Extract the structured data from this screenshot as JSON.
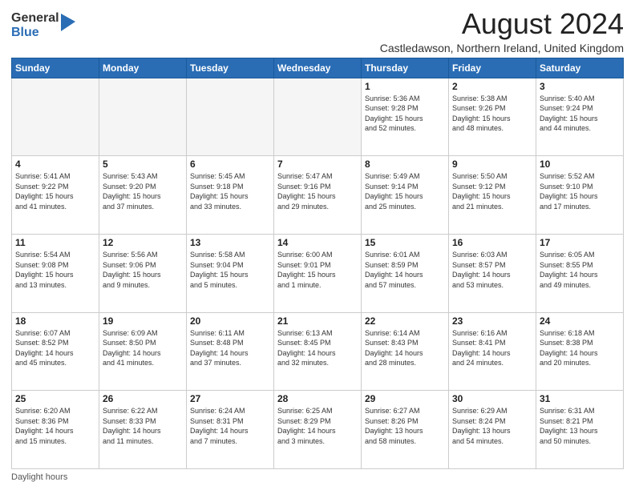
{
  "logo": {
    "general": "General",
    "blue": "Blue"
  },
  "title": "August 2024",
  "subtitle": "Castledawson, Northern Ireland, United Kingdom",
  "days_of_week": [
    "Sunday",
    "Monday",
    "Tuesday",
    "Wednesday",
    "Thursday",
    "Friday",
    "Saturday"
  ],
  "footer": "Daylight hours",
  "weeks": [
    [
      {
        "day": "",
        "info": ""
      },
      {
        "day": "",
        "info": ""
      },
      {
        "day": "",
        "info": ""
      },
      {
        "day": "",
        "info": ""
      },
      {
        "day": "1",
        "info": "Sunrise: 5:36 AM\nSunset: 9:28 PM\nDaylight: 15 hours\nand 52 minutes."
      },
      {
        "day": "2",
        "info": "Sunrise: 5:38 AM\nSunset: 9:26 PM\nDaylight: 15 hours\nand 48 minutes."
      },
      {
        "day": "3",
        "info": "Sunrise: 5:40 AM\nSunset: 9:24 PM\nDaylight: 15 hours\nand 44 minutes."
      }
    ],
    [
      {
        "day": "4",
        "info": "Sunrise: 5:41 AM\nSunset: 9:22 PM\nDaylight: 15 hours\nand 41 minutes."
      },
      {
        "day": "5",
        "info": "Sunrise: 5:43 AM\nSunset: 9:20 PM\nDaylight: 15 hours\nand 37 minutes."
      },
      {
        "day": "6",
        "info": "Sunrise: 5:45 AM\nSunset: 9:18 PM\nDaylight: 15 hours\nand 33 minutes."
      },
      {
        "day": "7",
        "info": "Sunrise: 5:47 AM\nSunset: 9:16 PM\nDaylight: 15 hours\nand 29 minutes."
      },
      {
        "day": "8",
        "info": "Sunrise: 5:49 AM\nSunset: 9:14 PM\nDaylight: 15 hours\nand 25 minutes."
      },
      {
        "day": "9",
        "info": "Sunrise: 5:50 AM\nSunset: 9:12 PM\nDaylight: 15 hours\nand 21 minutes."
      },
      {
        "day": "10",
        "info": "Sunrise: 5:52 AM\nSunset: 9:10 PM\nDaylight: 15 hours\nand 17 minutes."
      }
    ],
    [
      {
        "day": "11",
        "info": "Sunrise: 5:54 AM\nSunset: 9:08 PM\nDaylight: 15 hours\nand 13 minutes."
      },
      {
        "day": "12",
        "info": "Sunrise: 5:56 AM\nSunset: 9:06 PM\nDaylight: 15 hours\nand 9 minutes."
      },
      {
        "day": "13",
        "info": "Sunrise: 5:58 AM\nSunset: 9:04 PM\nDaylight: 15 hours\nand 5 minutes."
      },
      {
        "day": "14",
        "info": "Sunrise: 6:00 AM\nSunset: 9:01 PM\nDaylight: 15 hours\nand 1 minute."
      },
      {
        "day": "15",
        "info": "Sunrise: 6:01 AM\nSunset: 8:59 PM\nDaylight: 14 hours\nand 57 minutes."
      },
      {
        "day": "16",
        "info": "Sunrise: 6:03 AM\nSunset: 8:57 PM\nDaylight: 14 hours\nand 53 minutes."
      },
      {
        "day": "17",
        "info": "Sunrise: 6:05 AM\nSunset: 8:55 PM\nDaylight: 14 hours\nand 49 minutes."
      }
    ],
    [
      {
        "day": "18",
        "info": "Sunrise: 6:07 AM\nSunset: 8:52 PM\nDaylight: 14 hours\nand 45 minutes."
      },
      {
        "day": "19",
        "info": "Sunrise: 6:09 AM\nSunset: 8:50 PM\nDaylight: 14 hours\nand 41 minutes."
      },
      {
        "day": "20",
        "info": "Sunrise: 6:11 AM\nSunset: 8:48 PM\nDaylight: 14 hours\nand 37 minutes."
      },
      {
        "day": "21",
        "info": "Sunrise: 6:13 AM\nSunset: 8:45 PM\nDaylight: 14 hours\nand 32 minutes."
      },
      {
        "day": "22",
        "info": "Sunrise: 6:14 AM\nSunset: 8:43 PM\nDaylight: 14 hours\nand 28 minutes."
      },
      {
        "day": "23",
        "info": "Sunrise: 6:16 AM\nSunset: 8:41 PM\nDaylight: 14 hours\nand 24 minutes."
      },
      {
        "day": "24",
        "info": "Sunrise: 6:18 AM\nSunset: 8:38 PM\nDaylight: 14 hours\nand 20 minutes."
      }
    ],
    [
      {
        "day": "25",
        "info": "Sunrise: 6:20 AM\nSunset: 8:36 PM\nDaylight: 14 hours\nand 15 minutes."
      },
      {
        "day": "26",
        "info": "Sunrise: 6:22 AM\nSunset: 8:33 PM\nDaylight: 14 hours\nand 11 minutes."
      },
      {
        "day": "27",
        "info": "Sunrise: 6:24 AM\nSunset: 8:31 PM\nDaylight: 14 hours\nand 7 minutes."
      },
      {
        "day": "28",
        "info": "Sunrise: 6:25 AM\nSunset: 8:29 PM\nDaylight: 14 hours\nand 3 minutes."
      },
      {
        "day": "29",
        "info": "Sunrise: 6:27 AM\nSunset: 8:26 PM\nDaylight: 13 hours\nand 58 minutes."
      },
      {
        "day": "30",
        "info": "Sunrise: 6:29 AM\nSunset: 8:24 PM\nDaylight: 13 hours\nand 54 minutes."
      },
      {
        "day": "31",
        "info": "Sunrise: 6:31 AM\nSunset: 8:21 PM\nDaylight: 13 hours\nand 50 minutes."
      }
    ]
  ]
}
